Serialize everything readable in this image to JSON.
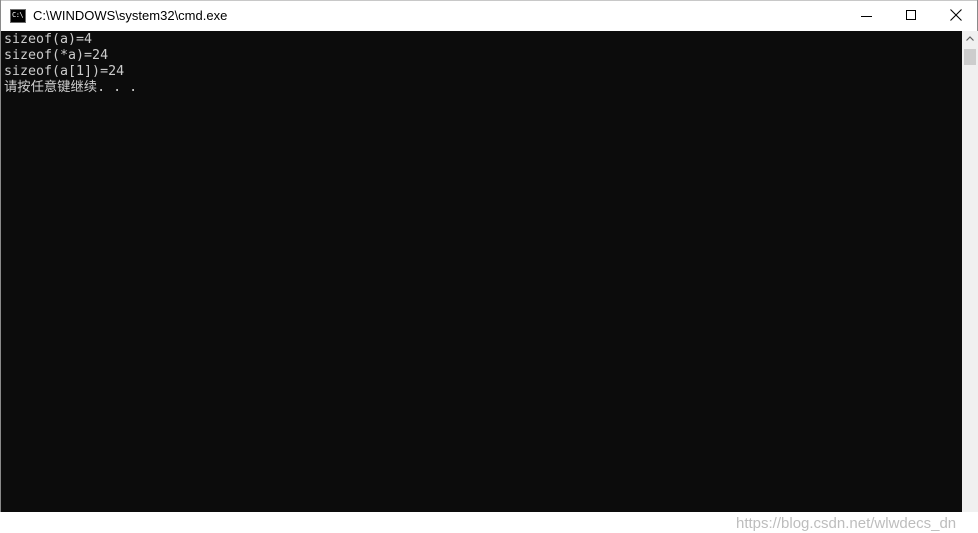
{
  "window": {
    "title": "C:\\WINDOWS\\system32\\cmd.exe",
    "icon": "cmd-icon",
    "icon_text": "C:\\"
  },
  "controls": {
    "minimize": "minimize-icon",
    "maximize": "maximize-icon",
    "close": "close-icon"
  },
  "console": {
    "lines": [
      "sizeof(a)=4",
      "sizeof(*a)=24",
      "sizeof(a[1])=24",
      "请按任意键继续. . ."
    ],
    "text_color": "#cccccc",
    "background": "#0c0c0c"
  },
  "watermark": {
    "text": "https://blog.csdn.net/wlwdecs_dn"
  }
}
